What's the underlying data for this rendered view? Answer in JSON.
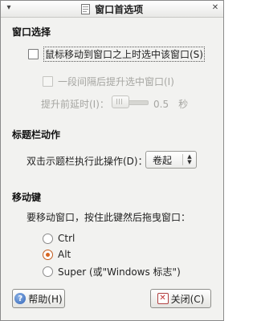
{
  "window": {
    "title": "窗口首选项",
    "close_glyph": "✕",
    "menu_glyph": "▾"
  },
  "window_selection": {
    "heading": "窗口选择",
    "focus_follow_label": "鼠标移动到窗口之上时选中该窗口(S)",
    "raise_after_delay_label": "一段间隔后提升选中窗口(I)",
    "delay_label": "提升前延时(I)：",
    "delay_value": "0.5",
    "delay_unit": "秒",
    "delay_fraction": 0.0
  },
  "titlebar_action": {
    "heading": "标题栏动作",
    "label": "双击示题栏执行此操作(D)：",
    "selected": "卷起"
  },
  "movement_key": {
    "heading": "移动键",
    "description": "要移动窗口，按住此键然后拖曳窗口：",
    "options": [
      "Ctrl",
      "Alt",
      "Super (或\"Windows 标志\")"
    ],
    "selected_index": 1
  },
  "buttons": {
    "help": "帮助(H)",
    "close": "关闭(C)"
  },
  "colors": {
    "accent": "#d9651f",
    "help_icon": "#2f63b8"
  }
}
